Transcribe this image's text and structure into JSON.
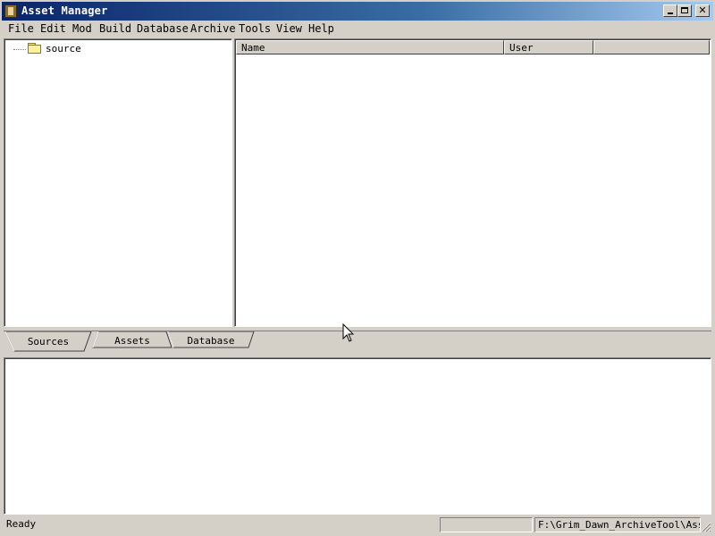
{
  "window": {
    "title": "Asset Manager",
    "caption_buttons": {
      "minimize_icon": "minimize-icon",
      "maximize_icon": "maximize-icon",
      "close_glyph": "✕"
    }
  },
  "menu": {
    "items": [
      "File",
      "Edit",
      "Mod",
      "Build",
      "Database",
      "Archive",
      "Tools",
      "View",
      "Help"
    ]
  },
  "tree": {
    "nodes": [
      {
        "label": "source",
        "icon": "folder-icon"
      }
    ]
  },
  "list": {
    "columns": [
      "Name",
      "User"
    ],
    "rows": []
  },
  "tabs": {
    "items": [
      "Sources",
      "Assets",
      "Database"
    ],
    "active": "Sources"
  },
  "status": {
    "text": "Ready",
    "middle": "",
    "path": "F:\\Grim_Dawn_ArchiveTool\\Asset"
  },
  "colors": {
    "titlebar_start": "#0a246a",
    "titlebar_end": "#a6caf0",
    "face": "#d4d0c8"
  }
}
